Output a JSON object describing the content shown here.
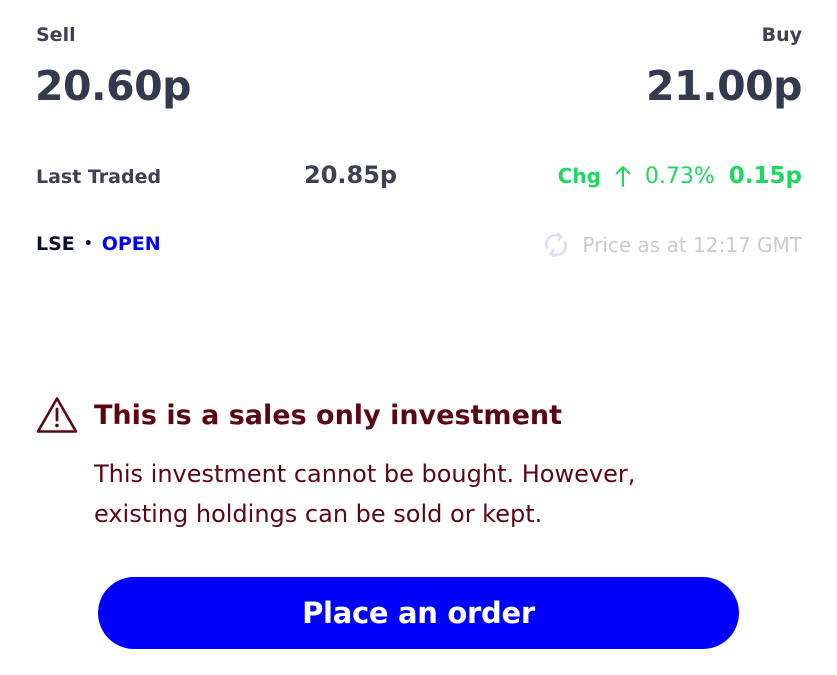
{
  "sell": {
    "label": "Sell",
    "price": "20.60p"
  },
  "buy": {
    "label": "Buy",
    "price": "21.00p"
  },
  "last_traded": {
    "label": "Last Traded",
    "value": "20.85p"
  },
  "change": {
    "label": "Chg",
    "direction_icon": "arrow-up-icon",
    "percent": "0.73%",
    "absolute": "0.15p",
    "color": "#1ed760"
  },
  "exchange": {
    "name": "LSE",
    "separator": "•",
    "status": "OPEN",
    "status_color": "#0000ff"
  },
  "price_time": {
    "icon": "refresh-icon",
    "text": "Price as at 12:17 GMT"
  },
  "warning": {
    "icon": "warning-triangle-icon",
    "title": "This is a sales only investment",
    "body": "This investment cannot be bought. However, existing holdings can be sold or kept.",
    "color": "#5c0613"
  },
  "order_button": {
    "label": "Place an order",
    "color": "#0000ff"
  }
}
